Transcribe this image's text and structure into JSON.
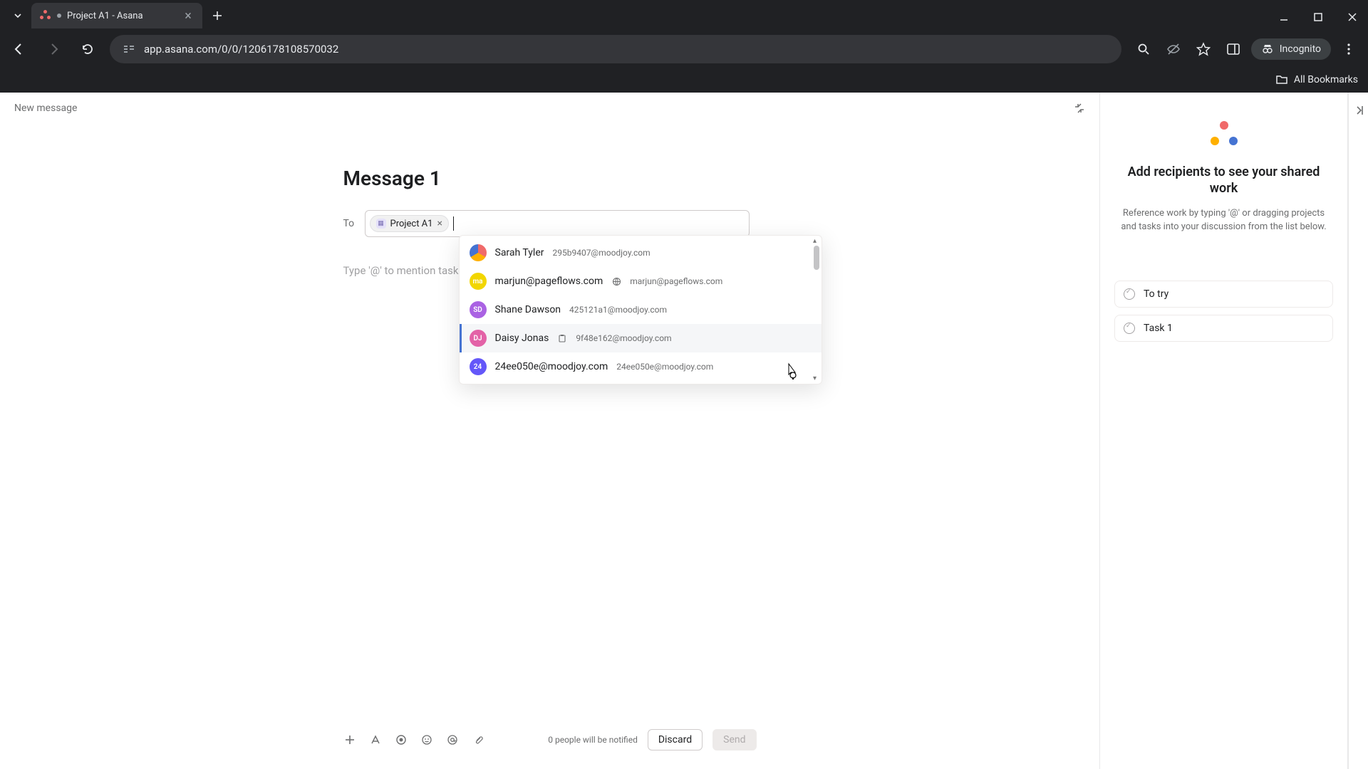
{
  "browser": {
    "tab_title": "Project A1 - Asana",
    "url": "app.asana.com/0/0/1206178108570032",
    "incognito_label": "Incognito",
    "all_bookmarks": "All Bookmarks"
  },
  "header": {
    "breadcrumb": "New message"
  },
  "message": {
    "subject": "Message 1",
    "to_label": "To",
    "chip_label": "Project A1",
    "body_placeholder": "Type '@' to mention tasks"
  },
  "dropdown": {
    "items": [
      {
        "name": "Sarah Tyler",
        "email": "295b9407@moodjoy.com",
        "avatar_bg": "multi",
        "initials": "",
        "badge": ""
      },
      {
        "name": "marjun@pageflows.com",
        "email": "marjun@pageflows.com",
        "avatar_bg": "#f2d600",
        "initials": "ma",
        "badge": "globe"
      },
      {
        "name": "Shane Dawson",
        "email": "425121a1@moodjoy.com",
        "avatar_bg": "#aa62e3",
        "initials": "SD",
        "badge": ""
      },
      {
        "name": "Daisy Jonas",
        "email": "9f48e162@moodjoy.com",
        "avatar_bg": "#e362a7",
        "initials": "DJ",
        "badge": "clipboard",
        "highlighted": true
      },
      {
        "name": "24ee050e@moodjoy.com",
        "email": "24ee050e@moodjoy.com",
        "avatar_bg": "#6457f9",
        "initials": "24",
        "badge": ""
      }
    ]
  },
  "footer": {
    "notify_text": "0 people will be notified",
    "discard_label": "Discard",
    "send_label": "Send"
  },
  "right_panel": {
    "title": "Add recipients to see your shared work",
    "description": "Reference work by typing '@' or dragging projects and tasks into your discussion from the list below.",
    "tasks": [
      {
        "label": "To try"
      },
      {
        "label": "Task 1"
      }
    ]
  }
}
